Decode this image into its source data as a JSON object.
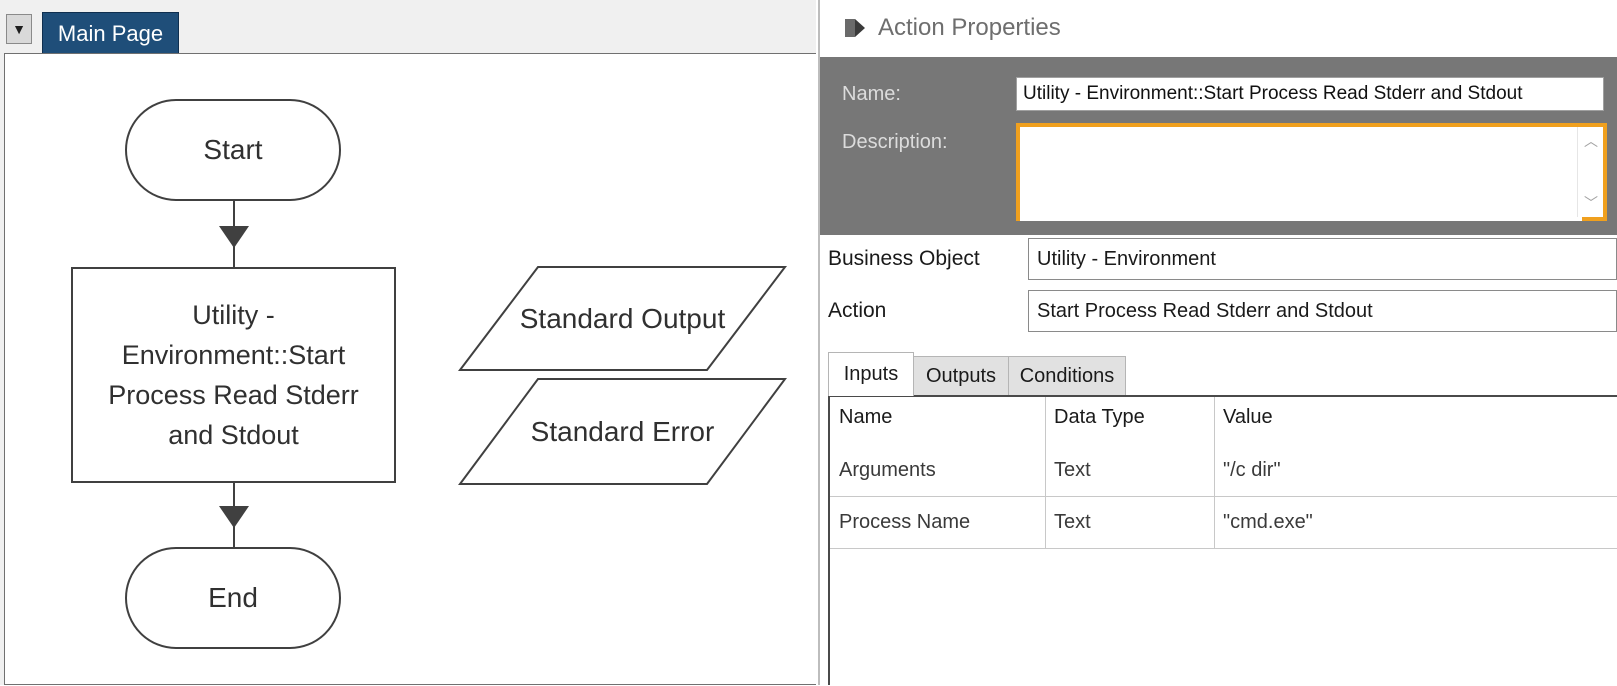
{
  "canvas": {
    "tab_label": "Main Page",
    "dropdown_glyph": "▼",
    "flow": {
      "start": "Start",
      "action_lines": [
        "Utility -",
        "Environment::Start",
        "Process Read Stderr",
        "and Stdout"
      ],
      "end": "End"
    },
    "data_items": [
      "Standard Output",
      "Standard Error"
    ]
  },
  "properties": {
    "title": "Action Properties",
    "title_icon": "action-icon",
    "name_label": "Name:",
    "name_value": "Utility - Environment::Start Process Read Stderr and Stdout",
    "description_label": "Description:",
    "description_value": "",
    "business_object_label": "Business Object",
    "business_object_value": "Utility - Environment",
    "action_label": "Action",
    "action_value": "Start Process Read Stderr and Stdout",
    "tabs": [
      "Inputs",
      "Outputs",
      "Conditions"
    ],
    "active_tab": "Inputs",
    "grid": {
      "headers": [
        "Name",
        "Data Type",
        "Value"
      ],
      "rows": [
        [
          "Arguments",
          "Text",
          "\"/c dir\""
        ],
        [
          "Process Name",
          "Text",
          "\"cmd.exe\""
        ]
      ]
    },
    "accent_color": "#f0a01e"
  }
}
